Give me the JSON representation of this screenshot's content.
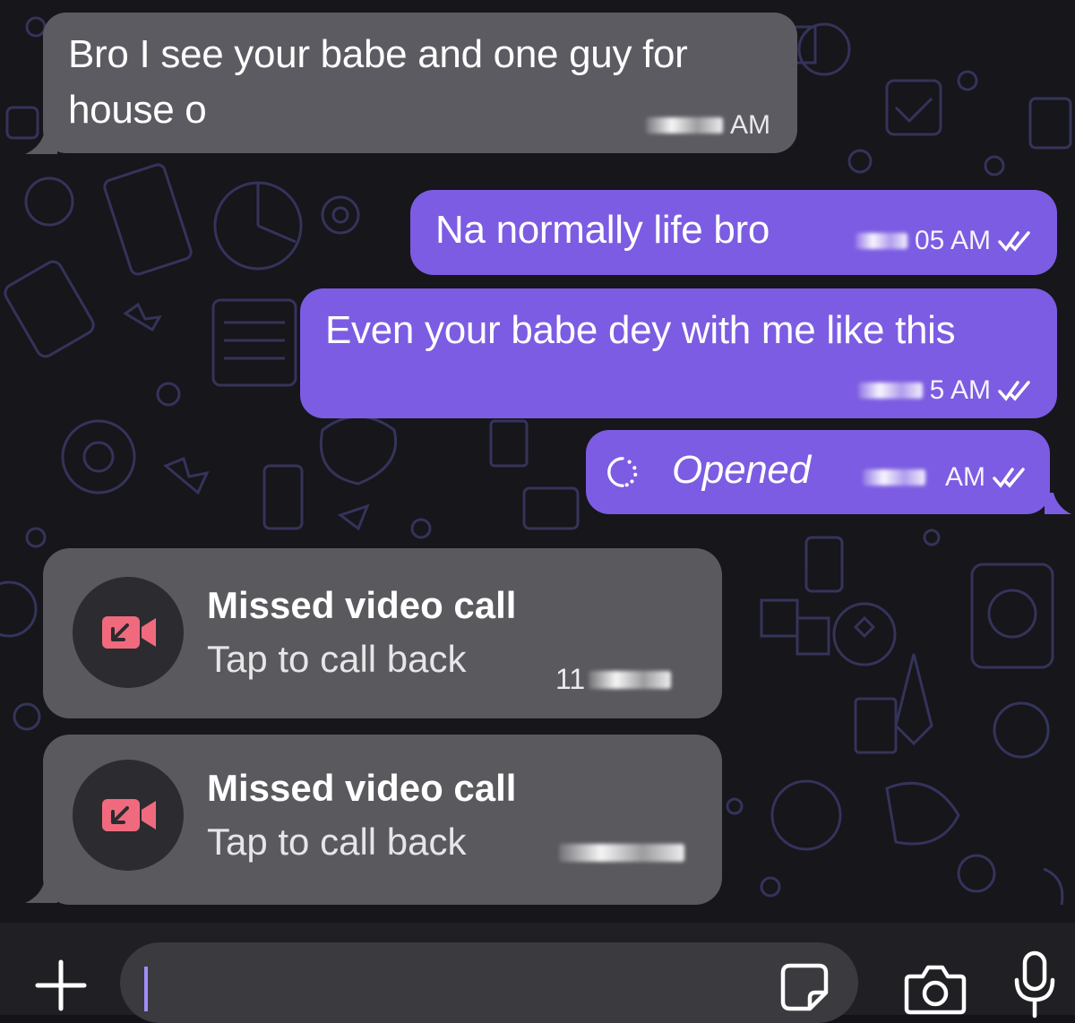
{
  "messages": [
    {
      "direction": "incoming",
      "text_line1": "Bro I see your babe and one guy for",
      "text_line2": "house o",
      "time_suffix": "AM"
    },
    {
      "direction": "outgoing",
      "text": "Na normally life bro",
      "time_suffix": "05 AM",
      "status": "read"
    },
    {
      "direction": "outgoing",
      "text": "Even your babe dey with me like this",
      "time_suffix": "5 AM",
      "status": "read"
    },
    {
      "direction": "outgoing",
      "text": "Opened",
      "time_suffix": "AM",
      "status": "read",
      "icon": "view-once-icon"
    }
  ],
  "calls": [
    {
      "title": "Missed video call",
      "subtitle": "Tap to call back",
      "time_prefix": "11"
    },
    {
      "title": "Missed video call",
      "subtitle": "Tap to call back",
      "time_prefix": ""
    }
  ],
  "composer": {
    "placeholder": ""
  },
  "colors": {
    "incoming_bubble": "#5c5b61",
    "outgoing_bubble": "#7c5ce2",
    "missed_call_icon": "#f06a7e",
    "background": "#16161b"
  }
}
